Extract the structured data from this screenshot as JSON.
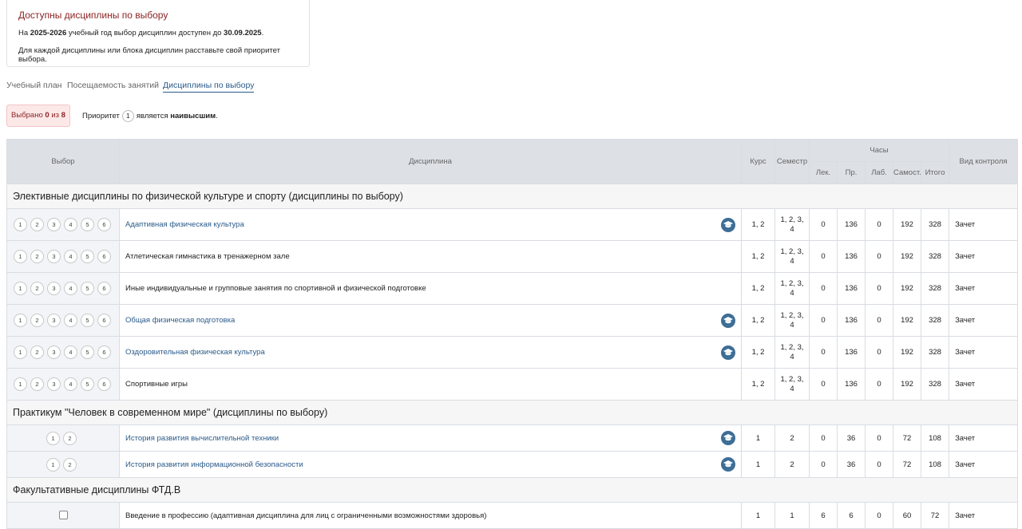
{
  "info": {
    "title": "Доступны дисциплины по выбору",
    "line1_prefix": "На ",
    "line1_year": "2025-2026",
    "line1_middle": " учебный год выбор дисциплин доступен до ",
    "line1_date": "30.09.2025",
    "line1_suffix": ".",
    "line2": "Для каждой дисциплины или блока дисциплин расставьте свой приоритет выбора."
  },
  "tabs": [
    "Учебный план",
    "Посещаемость занятий",
    "Дисциплины по выбору"
  ],
  "selected": {
    "prefix": "Выбрано ",
    "count": "0",
    "middle": " из ",
    "total": "8"
  },
  "priority": {
    "prefix": "Приоритет",
    "num": "1",
    "middle": "является ",
    "bold": "наивысшим",
    "suffix": "."
  },
  "table": {
    "headers": {
      "choice": "Выбор",
      "discipline": "Дисциплина",
      "course": "Курс",
      "semester": "Семестр",
      "hours": "Часы",
      "lec": "Лек.",
      "pr": "Пр.",
      "lab": "Лаб.",
      "self": "Самост.",
      "total": "Итого",
      "control": "Вид контроля"
    },
    "sections": [
      {
        "title": "Элективные дисциплины по физической культуре и спорту (дисциплины по выбору)",
        "priorities": [
          "1",
          "2",
          "3",
          "4",
          "5",
          "6"
        ],
        "rows": [
          {
            "name": "Адаптивная физическая культура",
            "link": true,
            "icon": "graduation-cap-icon",
            "course": "1, 2",
            "sem_a": "1, 2, 3,",
            "sem_b": "4",
            "lec": "0",
            "pr": "136",
            "lab": "0",
            "self": "192",
            "total": "328",
            "control": "Зачет"
          },
          {
            "name": "Атлетическая гимнастика в тренажерном зале",
            "link": false,
            "icon": "",
            "course": "1, 2",
            "sem_a": "1, 2, 3,",
            "sem_b": "4",
            "lec": "0",
            "pr": "136",
            "lab": "0",
            "self": "192",
            "total": "328",
            "control": "Зачет"
          },
          {
            "name": "Иные индивидуальные и групповые занятия по спортивной и физической подготовке",
            "link": false,
            "icon": "",
            "course": "1, 2",
            "sem_a": "1, 2, 3,",
            "sem_b": "4",
            "lec": "0",
            "pr": "136",
            "lab": "0",
            "self": "192",
            "total": "328",
            "control": "Зачет"
          },
          {
            "name": "Общая физическая подготовка",
            "link": true,
            "icon": "graduation-cap-icon",
            "course": "1, 2",
            "sem_a": "1, 2, 3,",
            "sem_b": "4",
            "lec": "0",
            "pr": "136",
            "lab": "0",
            "self": "192",
            "total": "328",
            "control": "Зачет"
          },
          {
            "name": "Оздоровительная физическая культура",
            "link": true,
            "icon": "graduation-cap-icon",
            "course": "1, 2",
            "sem_a": "1, 2, 3,",
            "sem_b": "4",
            "lec": "0",
            "pr": "136",
            "lab": "0",
            "self": "192",
            "total": "328",
            "control": "Зачет"
          },
          {
            "name": "Спортивные игры",
            "link": false,
            "icon": "",
            "course": "1, 2",
            "sem_a": "1, 2, 3,",
            "sem_b": "4",
            "lec": "0",
            "pr": "136",
            "lab": "0",
            "self": "192",
            "total": "328",
            "control": "Зачет"
          }
        ]
      },
      {
        "title": "Практикум \"Человек в современном мире\" (дисциплины по выбору)",
        "priorities": [
          "1",
          "2"
        ],
        "rows": [
          {
            "name": "История развития вычислительной техники",
            "link": true,
            "icon": "graduation-cap-icon",
            "course": "1",
            "sem_a": "2",
            "sem_b": "",
            "lec": "0",
            "pr": "36",
            "lab": "0",
            "self": "72",
            "total": "108",
            "control": "Зачет"
          },
          {
            "name": "История развития информационной безопасности",
            "link": true,
            "icon": "graduation-cap-icon",
            "course": "1",
            "sem_a": "2",
            "sem_b": "",
            "lec": "0",
            "pr": "36",
            "lab": "0",
            "self": "72",
            "total": "108",
            "control": "Зачет"
          }
        ]
      },
      {
        "title": "Факультативные дисциплины ФТД.В",
        "priorities": [],
        "rows": [
          {
            "name": "Введение в профессию (адаптивная дисциплина для лиц с ограниченными возможностями здоровья)",
            "link": false,
            "icon": "",
            "course": "1",
            "sem_a": "1",
            "sem_b": "",
            "lec": "6",
            "pr": "6",
            "lab": "0",
            "self": "60",
            "total": "72",
            "control": "Зачет"
          }
        ]
      }
    ]
  }
}
